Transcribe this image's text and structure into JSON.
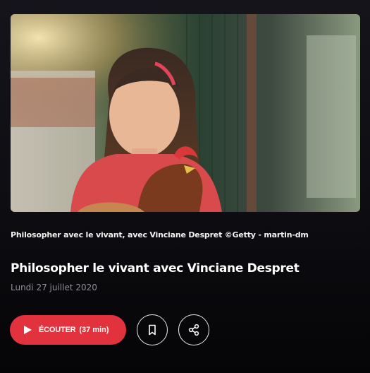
{
  "hero": {
    "image_description": "photo-girl-holding-hen"
  },
  "caption": "Philosopher avec le vivant, avec Vinciane Despret ©Getty - martin-dm",
  "episode": {
    "title": "Philosopher le vivant avec Vinciane Despret",
    "date": "Lundi 27 juillet 2020"
  },
  "actions": {
    "listen_label": "ÉCOUTER",
    "listen_duration": "(37 min)",
    "play_icon": "play-icon",
    "bookmark_icon": "bookmark-icon",
    "share_icon": "share-icon"
  },
  "colors": {
    "accent": "#e2323d",
    "background": "#0d0d12",
    "date_text": "#8f8e99"
  }
}
